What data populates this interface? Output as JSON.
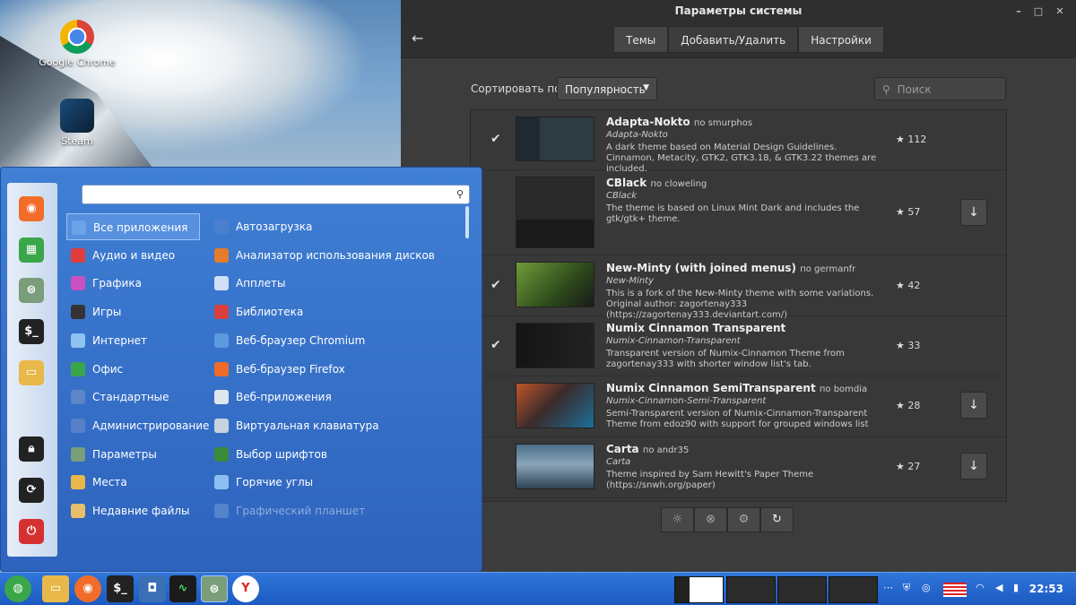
{
  "desktop": {
    "icons": [
      {
        "label": "Google Chrome",
        "icon": "chrome-icon"
      },
      {
        "label": "Steam",
        "icon": "steam-icon"
      }
    ]
  },
  "window": {
    "title": "Параметры системы",
    "controls": [
      "–",
      "□",
      "✕"
    ],
    "tabs": [
      {
        "label": "Темы",
        "active": false
      },
      {
        "label": "Добавить/Удалить",
        "active": true
      },
      {
        "label": "Настройки",
        "active": false
      }
    ],
    "sort_label": "Сортировать по",
    "sort_value": "Популярность",
    "search_placeholder": "Поиск",
    "themes": [
      {
        "name": "Adapta-Nokto",
        "author": "по smurphos",
        "sub": "Adapta-Nokto",
        "desc": "A dark theme based on Material Design Guidelines. Cinnamon, Metacity, GTK2, GTK3.18, & GTK3.22 themes are included.",
        "rating": "112",
        "installed": true
      },
      {
        "name": "CBlack",
        "author": "по cloweling",
        "sub": "CBlack",
        "desc": "The theme is based on Linux Mint Dark and includes the gtk/gtk+ theme.",
        "rating": "57",
        "installed": false
      },
      {
        "name": "New-Minty (with joined menus)",
        "author": "по germanfr",
        "sub": "New-Minty",
        "desc": "This is a fork of the New-Minty theme with some variations. Original author: zagortenay333 (https://zagortenay333.deviantart.com/)",
        "rating": "42",
        "installed": true
      },
      {
        "name": "Numix Cinnamon Transparent",
        "author": "",
        "sub": "Numix-Cinnamon-Transparent",
        "desc": "Transparent version of Numix-Cinnamon Theme from zagortenay333 with shorter window list's tab.",
        "rating": "33",
        "installed": true
      },
      {
        "name": "Numix Cinnamon SemiTransparent",
        "author": "по bomdia",
        "sub": "Numix-Cinnamon-Semi-Transparent",
        "desc": "Semi-Transparent version of Numix-Cinnamon-Transparent Theme from edoz90 with support for grouped windows list",
        "rating": "28",
        "installed": false
      },
      {
        "name": "Carta",
        "author": "по andr35",
        "sub": "Carta",
        "desc": "Theme inspired by Sam Hewitt's Paper Theme (https://snwh.org/paper)",
        "rating": "27",
        "installed": false
      }
    ],
    "bottom_buttons": [
      "lightbulb-icon",
      "remove-icon",
      "gear-icon",
      "refresh-icon"
    ]
  },
  "menu": {
    "categories_left": [
      {
        "label": "Все приложения",
        "icon": "grid-icon",
        "color": "#6aa3e8"
      },
      {
        "label": "Аудио и видео",
        "icon": "media-icon",
        "color": "#e03c3c"
      },
      {
        "label": "Графика",
        "icon": "graphics-icon",
        "color": "#c850c0"
      },
      {
        "label": "Игры",
        "icon": "games-icon",
        "color": "#333333"
      },
      {
        "label": "Интернет",
        "icon": "cloud-icon",
        "color": "#8fc3f0"
      },
      {
        "label": "Офис",
        "icon": "office-icon",
        "color": "#3aa64a"
      },
      {
        "label": "Стандартные",
        "icon": "scissors-icon",
        "color": "#5c86c8"
      },
      {
        "label": "Администрирование",
        "icon": "admin-icon",
        "color": "#5680c8"
      },
      {
        "label": "Параметры",
        "icon": "settings-icon",
        "color": "#7a9d7a"
      },
      {
        "label": "Места",
        "icon": "folder-icon",
        "color": "#e9b84a"
      },
      {
        "label": "Недавние файлы",
        "icon": "recent-icon",
        "color": "#e9c06a"
      }
    ],
    "categories_right": [
      {
        "label": "Автозагрузка",
        "icon": "autostart-icon",
        "color": "#4a7fd0"
      },
      {
        "label": "Анализатор использования дисков",
        "icon": "disk-usage-icon",
        "color": "#e57c2c"
      },
      {
        "label": "Апплеты",
        "icon": "applets-icon",
        "color": "#cfe0f8"
      },
      {
        "label": "Библиотека",
        "icon": "library-icon",
        "color": "#d94040"
      },
      {
        "label": "Веб-браузер Chromium",
        "icon": "chromium-icon",
        "color": "#5c9ae0"
      },
      {
        "label": "Веб-браузер Firefox",
        "icon": "firefox-icon",
        "color": "#f06a2a"
      },
      {
        "label": "Веб-приложения",
        "icon": "webapps-icon",
        "color": "#e0e6ee"
      },
      {
        "label": "Виртуальная клавиатура",
        "icon": "keyboard-icon",
        "color": "#c8d2de"
      },
      {
        "label": "Выбор шрифтов",
        "icon": "fonts-icon",
        "color": "#3a8a3a"
      },
      {
        "label": "Горячие углы",
        "icon": "hotcorner-icon",
        "color": "#8cc0f0"
      },
      {
        "label": "Графический планшет",
        "icon": "tablet-icon",
        "color": "#7fa6d8"
      }
    ]
  },
  "taskbar": {
    "clock": "22:53"
  }
}
